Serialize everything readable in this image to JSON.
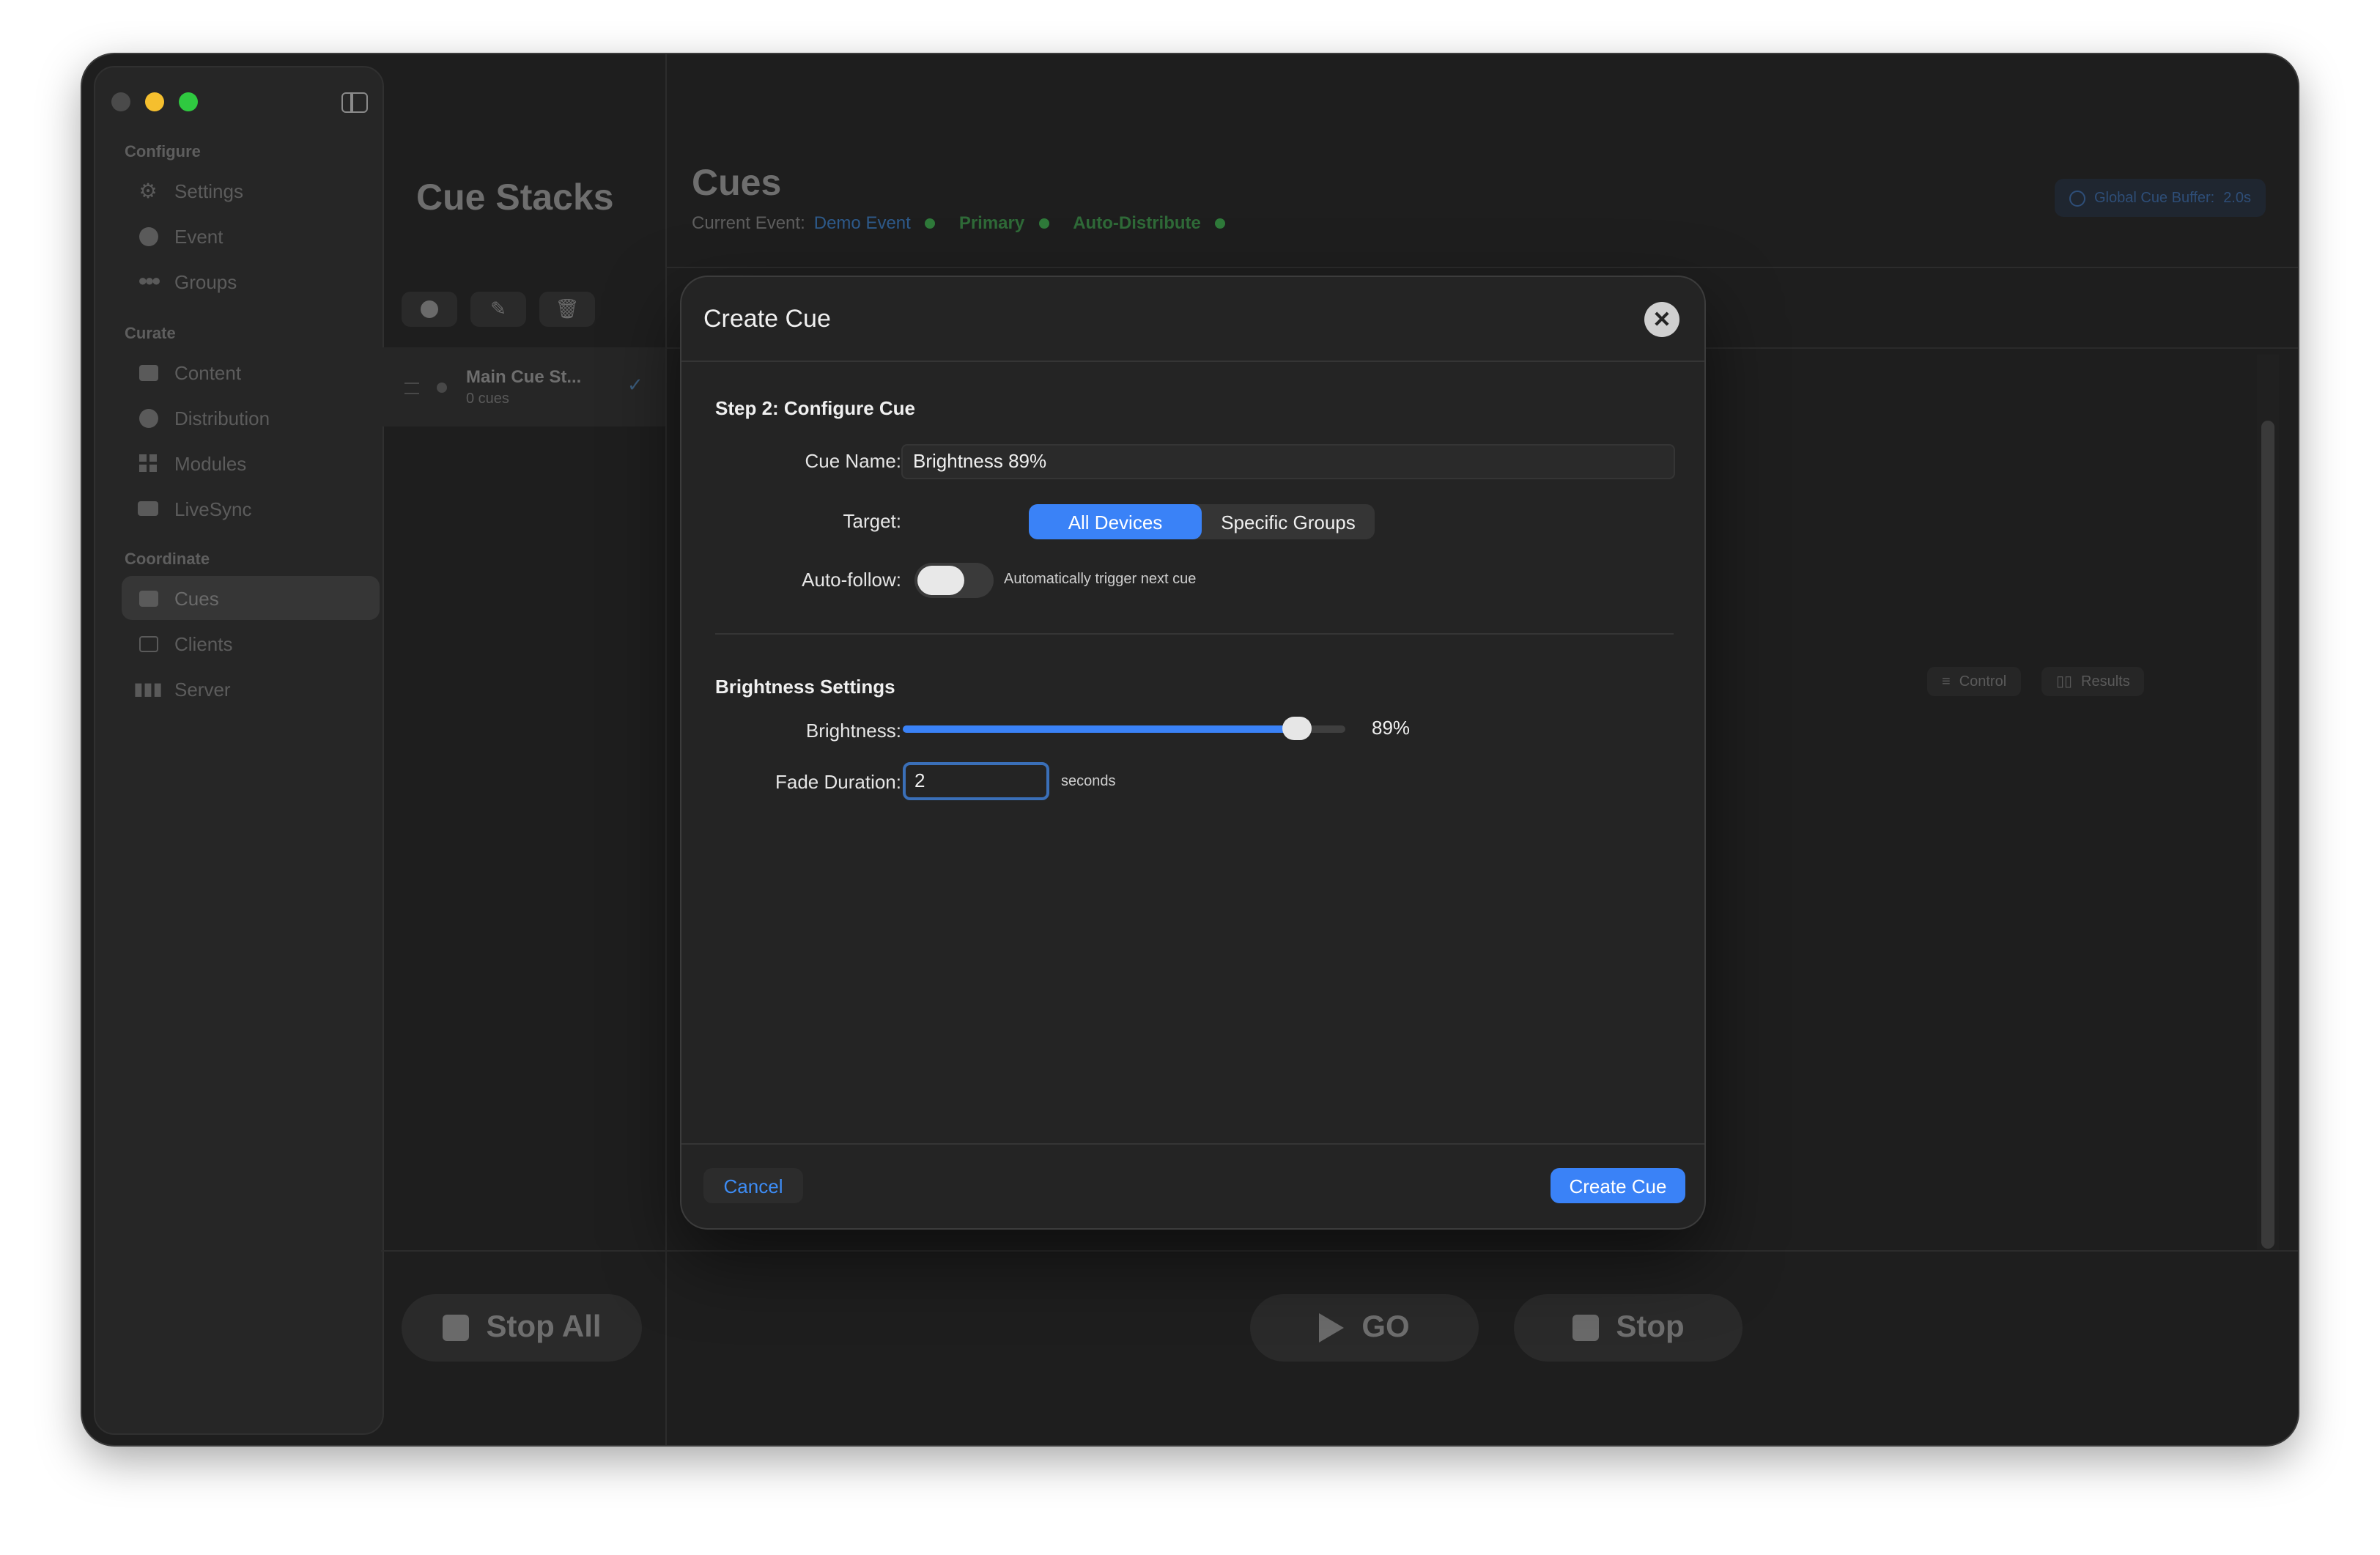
{
  "sidebar": {
    "sections": [
      {
        "title": "Configure",
        "items": [
          {
            "label": "Settings",
            "icon": "gear-icon"
          },
          {
            "label": "Event",
            "icon": "event-icon"
          },
          {
            "label": "Groups",
            "icon": "groups-icon"
          }
        ]
      },
      {
        "title": "Curate",
        "items": [
          {
            "label": "Content",
            "icon": "content-icon"
          },
          {
            "label": "Distribution",
            "icon": "distribution-icon"
          },
          {
            "label": "Modules",
            "icon": "modules-icon"
          },
          {
            "label": "LiveSync",
            "icon": "camera-icon"
          }
        ]
      },
      {
        "title": "Coordinate",
        "items": [
          {
            "label": "Cues",
            "icon": "cues-icon"
          },
          {
            "label": "Clients",
            "icon": "clients-icon"
          },
          {
            "label": "Server",
            "icon": "server-icon"
          }
        ]
      }
    ],
    "active_item": "Cues"
  },
  "cue_stacks": {
    "title": "Cue Stacks",
    "items": [
      {
        "name": "Main Cue St...",
        "sub": "0 cues"
      }
    ],
    "stop_all_label": "Stop All"
  },
  "main": {
    "title": "Cues",
    "current_event_label": "Current Event:",
    "event_name": "Demo Event",
    "primary_label": "Primary",
    "auto_distribute_label": "Auto-Distribute",
    "global_buffer_label": "Global Cue Buffer:",
    "global_buffer_value": "2.0s",
    "tabs": [
      {
        "label": "Control"
      },
      {
        "label": "Results"
      }
    ],
    "go_label": "GO",
    "stop_label": "Stop"
  },
  "modal": {
    "title": "Create Cue",
    "step_title": "Step 2: Configure Cue",
    "cue_name_label": "Cue Name:",
    "cue_name_value": "Brightness 89%",
    "target_label": "Target:",
    "target_options": [
      "All Devices",
      "Specific Groups"
    ],
    "target_selected": "All Devices",
    "auto_follow_label": "Auto-follow:",
    "auto_follow_on": false,
    "auto_follow_hint": "Automatically trigger next cue",
    "brightness_section": "Brightness Settings",
    "brightness_label": "Brightness:",
    "brightness_value": 89,
    "brightness_display": "89%",
    "fade_label": "Fade Duration:",
    "fade_value": "2",
    "fade_unit": "seconds",
    "cancel_label": "Cancel",
    "create_label": "Create Cue"
  },
  "colors": {
    "accent": "#3a82f7",
    "status_green": "#2f7a3a",
    "link": "#3d8cf5"
  }
}
